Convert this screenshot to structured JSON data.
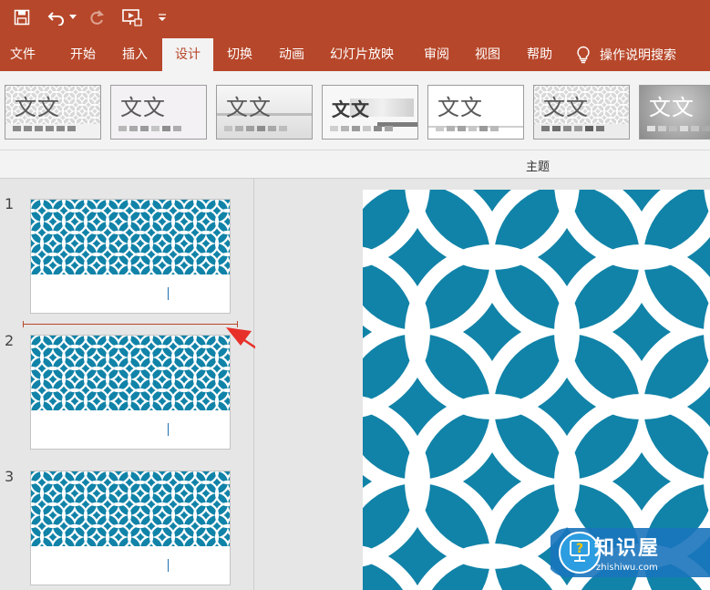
{
  "quick_access": {
    "icons": [
      "save-icon",
      "undo-icon",
      "undo-dropdown-icon",
      "redo-icon",
      "present-from-start-icon",
      "customize-toolbar-icon"
    ]
  },
  "tabs": [
    {
      "label": "文件"
    },
    {
      "label": "开始"
    },
    {
      "label": "插入"
    },
    {
      "label": "设计",
      "active": true
    },
    {
      "label": "切换"
    },
    {
      "label": "动画"
    },
    {
      "label": "幻灯片放映"
    },
    {
      "label": "审阅"
    },
    {
      "label": "视图"
    },
    {
      "label": "帮助"
    }
  ],
  "tell_me": {
    "label": "操作说明搜索",
    "icon": "lightbulb-icon"
  },
  "themes": [
    {
      "text": "文文",
      "style": "pattern-gray"
    },
    {
      "text": "文文",
      "style": "plain-light"
    },
    {
      "text": "文文",
      "style": "gradient-gray"
    },
    {
      "text": "文文",
      "style": "brush-gray"
    },
    {
      "text": "文文",
      "style": "plain-white"
    },
    {
      "text": "文文",
      "style": "pattern-gray-2"
    },
    {
      "text": "文文",
      "style": "dark-gray"
    }
  ],
  "ribbon_group_label": "主题",
  "slides": [
    {
      "number": "1"
    },
    {
      "number": "2"
    },
    {
      "number": "3"
    }
  ],
  "watermark": {
    "title": "知识屋",
    "subtitle": "zhishiwu.com"
  },
  "colors": {
    "accent": "#b7472a",
    "slide_pattern": "#1183a8",
    "pattern_lines": "#ffffff",
    "arrow": "#e8302a"
  }
}
